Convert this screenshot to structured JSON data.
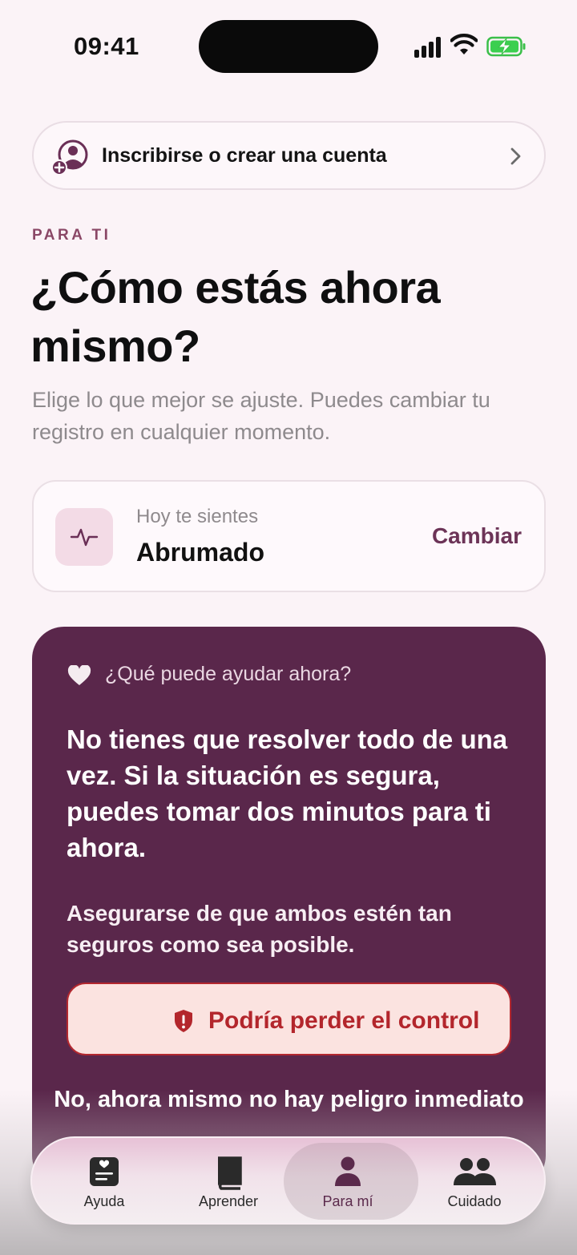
{
  "status_bar": {
    "time": "09:41"
  },
  "account": {
    "label": "Inscribirse o crear una cuenta"
  },
  "header": {
    "eyebrow": "PARA TI",
    "title": "¿Cómo estás ahora mismo?",
    "subtitle": "Elige lo que mejor se ajuste. Puedes cambiar tu registro en cualquier momento."
  },
  "feeling": {
    "caption": "Hoy te sientes",
    "value": "Abrumado",
    "change_label": "Cambiar"
  },
  "help": {
    "question": "¿Qué puede ayudar ahora?",
    "main_text": "No tienes que resolver todo de una vez. Si la situación es segura, puedes tomar dos minutos para ti ahora.",
    "secondary_text": "Asegurarse de que ambos estén tan seguros como sea posible.",
    "danger_button": "Podría perder el control",
    "no_danger_option": "No, ahora mismo no hay peligro inmediato"
  },
  "tabs": [
    {
      "label": "Ayuda",
      "icon": "help-card-icon"
    },
    {
      "label": "Aprender",
      "icon": "book-icon"
    },
    {
      "label": "Para mí",
      "icon": "person-icon",
      "active": true
    },
    {
      "label": "Cuidado",
      "icon": "people-icon"
    }
  ],
  "colors": {
    "accent": "#5a274b",
    "danger": "#b3262c",
    "background": "#fbf3f7"
  }
}
